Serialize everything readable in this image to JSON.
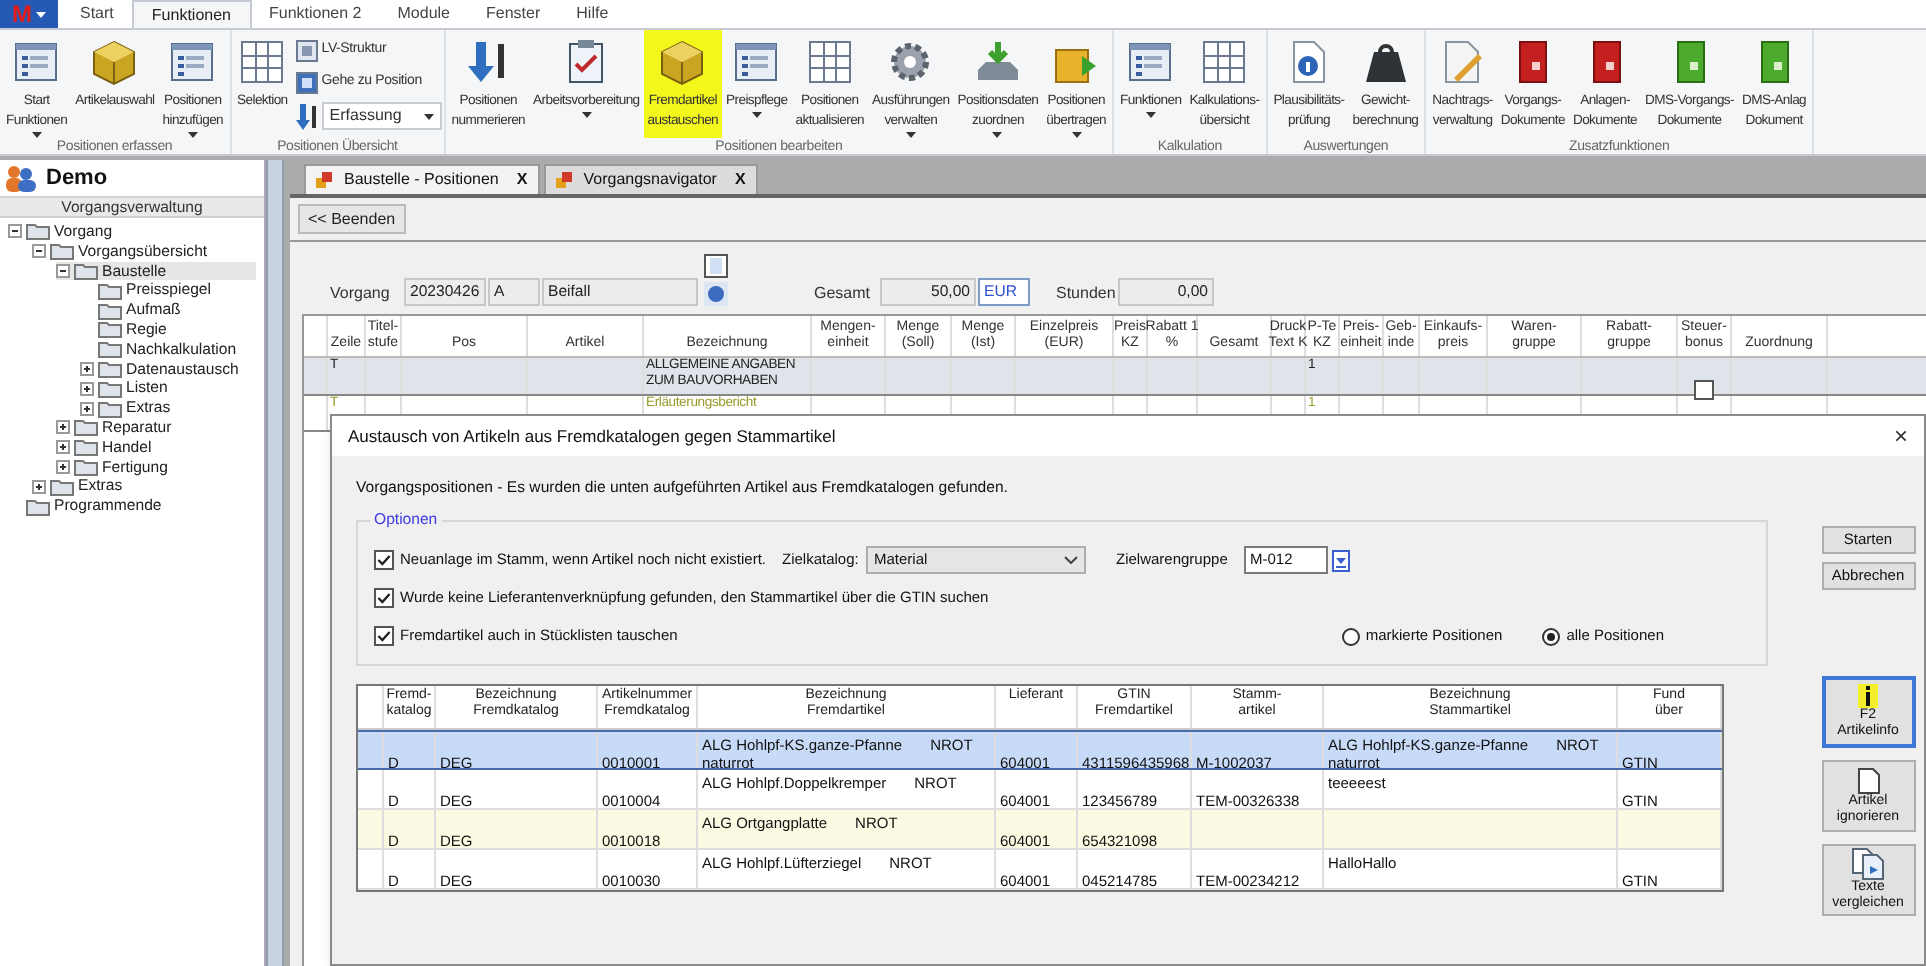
{
  "app_button": "M",
  "ribbon": {
    "tabs": [
      {
        "label": "Start",
        "selected": false
      },
      {
        "label": "Funktionen",
        "selected": true
      },
      {
        "label": "Funktionen 2",
        "selected": false
      },
      {
        "label": "Module",
        "selected": false
      },
      {
        "label": "Fenster",
        "selected": false
      },
      {
        "label": "Hilfe",
        "selected": false
      }
    ],
    "groups": [
      {
        "label": "Positionen erfassen",
        "items": [
          {
            "kind": "large",
            "lines": [
              "Start",
              "Funktionen"
            ],
            "dropdown": true,
            "highlighted": false
          },
          {
            "kind": "large",
            "lines": [
              "Artikelauswahl"
            ],
            "dropdown": false,
            "highlighted": false
          },
          {
            "kind": "large",
            "lines": [
              "Positionen",
              "hinzufügen"
            ],
            "dropdown": true,
            "highlighted": false
          }
        ]
      },
      {
        "label": "Positionen Übersicht",
        "items": [
          {
            "kind": "large",
            "lines": [
              "Selektion"
            ],
            "dropdown": false,
            "highlighted": false
          },
          {
            "kind": "small",
            "label": "LV-Struktur"
          },
          {
            "kind": "small",
            "label": "Gehe zu Position"
          },
          {
            "kind": "select",
            "value": "Erfassung"
          }
        ]
      },
      {
        "label": "Positionen bearbeiten",
        "items": [
          {
            "kind": "large",
            "lines": [
              "Positionen",
              "nummerieren"
            ],
            "dropdown": false,
            "highlighted": false
          },
          {
            "kind": "large",
            "lines": [
              "Arbeitsvorbereitung"
            ],
            "dropdown": true,
            "highlighted": false
          },
          {
            "kind": "large",
            "lines": [
              "Fremdartikel",
              "austauschen"
            ],
            "dropdown": false,
            "highlighted": true
          },
          {
            "kind": "large",
            "lines": [
              "Preispflege"
            ],
            "dropdown": true,
            "highlighted": false
          },
          {
            "kind": "large",
            "lines": [
              "Positionen",
              "aktualisieren"
            ],
            "dropdown": false,
            "highlighted": false
          },
          {
            "kind": "large",
            "lines": [
              "Ausführungen",
              "verwalten"
            ],
            "dropdown": true,
            "highlighted": false
          },
          {
            "kind": "large",
            "lines": [
              "Positionsdaten",
              "zuordnen"
            ],
            "dropdown": true,
            "highlighted": false
          },
          {
            "kind": "large",
            "lines": [
              "Positionen",
              "übertragen"
            ],
            "dropdown": true,
            "highlighted": false
          }
        ]
      },
      {
        "label": "Kalkulation",
        "items": [
          {
            "kind": "large",
            "lines": [
              "Funktionen"
            ],
            "dropdown": true,
            "highlighted": false
          },
          {
            "kind": "large",
            "lines": [
              "Kalkulations-",
              "übersicht"
            ],
            "dropdown": false,
            "highlighted": false
          }
        ]
      },
      {
        "label": "Auswertungen",
        "items": [
          {
            "kind": "large",
            "lines": [
              "Plausibilitäts-",
              "prüfung"
            ],
            "dropdown": false,
            "highlighted": false
          },
          {
            "kind": "large",
            "lines": [
              "Gewicht-",
              "berechnung"
            ],
            "dropdown": false,
            "highlighted": false
          }
        ]
      },
      {
        "label": "Zusatzfunktionen",
        "items": [
          {
            "kind": "large",
            "lines": [
              "Nachtrags-",
              "verwaltung"
            ],
            "dropdown": false,
            "highlighted": false
          },
          {
            "kind": "large",
            "lines": [
              "Vorgangs-",
              "Dokumente"
            ],
            "dropdown": false,
            "highlighted": false
          },
          {
            "kind": "large",
            "lines": [
              "Anlagen-",
              "Dokumente"
            ],
            "dropdown": false,
            "highlighted": false
          },
          {
            "kind": "large",
            "lines": [
              "DMS-Vorgangs-",
              "Dokumente"
            ],
            "dropdown": false,
            "highlighted": false
          },
          {
            "kind": "large",
            "lines": [
              "DMS-Anlag",
              "Dokument"
            ],
            "dropdown": false,
            "highlighted": false
          }
        ]
      }
    ]
  },
  "sidebar": {
    "title": "Demo",
    "section": "Vorgangsverwaltung",
    "tree": [
      {
        "label": "Vorgang",
        "kind": "branch",
        "expanded": true,
        "selected": false,
        "children": [
          {
            "label": "Vorgangsübersicht",
            "kind": "branch",
            "expanded": true,
            "selected": false,
            "children": [
              {
                "label": "Baustelle",
                "kind": "branch",
                "expanded": true,
                "selected": true,
                "children": [
                  {
                    "label": "Preisspiegel",
                    "kind": "leaf",
                    "selected": false
                  },
                  {
                    "label": "Aufmaß",
                    "kind": "leaf",
                    "selected": false
                  },
                  {
                    "label": "Regie",
                    "kind": "leaf",
                    "selected": false
                  },
                  {
                    "label": "Nachkalkulation",
                    "kind": "leaf",
                    "selected": false
                  },
                  {
                    "label": "Datenaustausch",
                    "kind": "branch",
                    "expanded": false,
                    "selected": false
                  },
                  {
                    "label": "Listen",
                    "kind": "branch",
                    "expanded": false,
                    "selected": false
                  },
                  {
                    "label": "Extras",
                    "kind": "branch",
                    "expanded": false,
                    "selected": false
                  }
                ]
              },
              {
                "label": "Reparatur",
                "kind": "branch",
                "expanded": false,
                "selected": false
              },
              {
                "label": "Handel",
                "kind": "branch",
                "expanded": false,
                "selected": false
              },
              {
                "label": "Fertigung",
                "kind": "branch",
                "expanded": false,
                "selected": false
              }
            ]
          },
          {
            "label": "Extras",
            "kind": "branch",
            "expanded": false,
            "selected": false
          }
        ]
      },
      {
        "label": "Programmende",
        "kind": "leaf",
        "selected": false
      }
    ]
  },
  "doc_tabs": [
    {
      "label": "Baustelle - Positionen",
      "selected": true,
      "close": "X"
    },
    {
      "label": "Vorgangsnavigator",
      "selected": false,
      "close": "X"
    }
  ],
  "back_button": "<< Beenden",
  "form": {
    "vorgang_label": "Vorgang",
    "vorgang_nr": "20230426",
    "vorgang_typ": "A",
    "vorgang_name": "Beifall",
    "gesamt_label": "Gesamt",
    "gesamt": "50,00",
    "currency": "EUR",
    "stunden_label": "Stunden",
    "stunden": "0,00"
  },
  "grid": {
    "columns": [
      [
        "Zeile"
      ],
      [
        "Titel-",
        "stufe"
      ],
      [
        "Pos"
      ],
      [
        "Artikel"
      ],
      [
        "Bezeichnung"
      ],
      [
        "Mengen-",
        "einheit"
      ],
      [
        "Menge",
        "(Soll)"
      ],
      [
        "Menge",
        "(Ist)"
      ],
      [
        "Einzelpreis",
        "(EUR)"
      ],
      [
        "Preis",
        "KZ"
      ],
      [
        "Rabatt 1",
        "%"
      ],
      [
        "Gesamt"
      ],
      [
        "Druck",
        "Text K"
      ],
      [
        "P-Te",
        "KZ"
      ],
      [
        "Preis-",
        "einheit"
      ],
      [
        "Geb-",
        "inde"
      ],
      [
        "Einkaufs-",
        "preis"
      ],
      [
        "Waren-",
        "gruppe"
      ],
      [
        "Rabatt-",
        "gruppe"
      ],
      [
        "Steuer-",
        "bonus"
      ],
      [
        "Zuordnung"
      ]
    ],
    "rows": [
      {
        "kind": "title",
        "selected": true,
        "zeile": "T",
        "bezeichnung": "ALLGEMEINE ANGABEN ZUM BAUVORHABEN",
        "p_text_kz": "1",
        "steuerbonus": false
      },
      {
        "kind": "text",
        "selected": false,
        "zeile": "T",
        "bezeichnung": "Erläuterungsbericht",
        "p_text_kz": "1"
      }
    ]
  },
  "dialog": {
    "title": "Austausch von Artikeln aus Fremdkatalogen gegen Stammartikel",
    "close": "×",
    "message": "Vorgangspositionen - Es wurden die unten aufgeführten Artikel aus Fremdkatalogen gefunden.",
    "options": {
      "title": "Optionen",
      "checks": [
        {
          "label": "Neuanlage im Stamm, wenn Artikel noch nicht existiert.",
          "checked": true
        },
        {
          "label": "Wurde keine Lieferantenverknüpfung gefunden, den Stammartikel über die GTIN suchen",
          "checked": true
        },
        {
          "label": "Fremdartikel auch in Stücklisten tauschen",
          "checked": true
        }
      ],
      "zielkatalog_label": "Zielkatalog:",
      "zielkatalog": "Material",
      "zielwarengruppe_label": "Zielwarengruppe",
      "zielwarengruppe": "M-012",
      "radios": [
        {
          "label": "markierte Positionen",
          "selected": false
        },
        {
          "label": "alle Positionen",
          "selected": true
        }
      ]
    },
    "buttons": [
      "Starten",
      "Abbrechen"
    ],
    "table": {
      "columns": [
        [
          "Fremd-",
          "katalog"
        ],
        [
          "Bezeichnung",
          "Fremdkatalog"
        ],
        [
          "Artikelnummer",
          "Fremdkatalog"
        ],
        [
          "Bezeichnung",
          "Fremdartikel"
        ],
        [
          "Lieferant"
        ],
        [
          "GTIN",
          "Fremdartikel"
        ],
        [
          "Stamm-",
          "artikel"
        ],
        [
          "Bezeichnung",
          "Stammartikel"
        ],
        [
          "Fund",
          "über"
        ]
      ],
      "rows": [
        {
          "selected": true,
          "highlighted": false,
          "katalog": "D",
          "bez_katalog": "DEG",
          "artnr": "0010001",
          "fremdartikel": {
            "name": "ALG Hohlpf-KS.ganze-Pfanne",
            "code": "NROT",
            "note": "naturrot"
          },
          "lieferant": "604001",
          "gtin": "4311596435968",
          "stammartikel": "M-1002037",
          "stamm_bez": {
            "name": "ALG Hohlpf-KS.ganze-Pfanne",
            "code": "NROT",
            "note": "naturrot"
          },
          "fund": "GTIN"
        },
        {
          "selected": false,
          "highlighted": false,
          "katalog": "D",
          "bez_katalog": "DEG",
          "artnr": "0010004",
          "fremdartikel": {
            "name": "ALG Hohlpf.Doppelkremper",
            "code": "NROT"
          },
          "lieferant": "604001",
          "gtin": "123456789",
          "stammartikel": "TEM-00326338",
          "stamm_bez": {
            "name": "teeeeest"
          },
          "fund": "GTIN"
        },
        {
          "selected": false,
          "highlighted": true,
          "katalog": "D",
          "bez_katalog": "DEG",
          "artnr": "0010018",
          "fremdartikel": {
            "name": "ALG Ortgangplatte",
            "code": "NROT"
          },
          "lieferant": "604001",
          "gtin": "654321098"
        },
        {
          "selected": false,
          "highlighted": false,
          "katalog": "D",
          "bez_katalog": "DEG",
          "artnr": "0010030",
          "fremdartikel": {
            "name": "ALG Hohlpf.Lüfterziegel",
            "code": "NROT"
          },
          "lieferant": "604001",
          "gtin": "045214785",
          "stammartikel": "TEM-00234212",
          "stamm_bez": {
            "name": "HalloHallo"
          },
          "fund": "GTIN"
        }
      ]
    },
    "side_buttons": [
      {
        "lines": [
          "F2",
          "Artikelinfo"
        ],
        "selected": true
      },
      {
        "lines": [
          "Artikel",
          "ignorieren"
        ],
        "selected": false
      },
      {
        "lines": [
          "Texte",
          "vergleichen"
        ],
        "selected": false
      }
    ]
  }
}
